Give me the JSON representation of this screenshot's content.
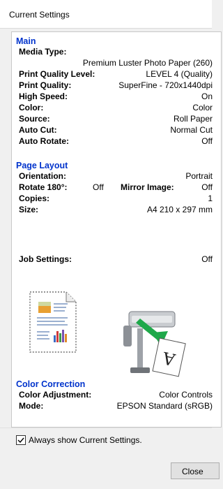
{
  "window": {
    "title": "Current Settings"
  },
  "main": {
    "heading": "Main",
    "media_type_label": "Media Type:",
    "media_type_value": "Premium Luster Photo Paper (260)",
    "print_quality_level_label": "Print Quality Level:",
    "print_quality_level_value": "LEVEL 4 (Quality)",
    "print_quality_label": "Print Quality:",
    "print_quality_value": "SuperFine - 720x1440dpi",
    "high_speed_label": "High Speed:",
    "high_speed_value": "On",
    "color_label": "Color:",
    "color_value": "Color",
    "source_label": "Source:",
    "source_value": "Roll Paper",
    "auto_cut_label": "Auto Cut:",
    "auto_cut_value": "Normal Cut",
    "auto_rotate_label": "Auto Rotate:",
    "auto_rotate_value": "Off"
  },
  "page_layout": {
    "heading": "Page Layout",
    "orientation_label": "Orientation:",
    "orientation_value": "Portrait",
    "rotate_label": "Rotate 180°:",
    "rotate_value": "Off",
    "mirror_label": "Mirror Image:",
    "mirror_value": "Off",
    "copies_label": "Copies:",
    "copies_value": "1",
    "size_label": "Size:",
    "size_value": "A4 210 x 297 mm",
    "job_settings_label": "Job Settings:",
    "job_settings_value": "Off"
  },
  "color_correction": {
    "heading": "Color Correction",
    "adjustment_label": "Color Adjustment:",
    "adjustment_value": "Color Controls",
    "mode_label": "Mode:",
    "mode_value": "EPSON Standard (sRGB)"
  },
  "footer": {
    "always_show_label": "Always show Current Settings.",
    "always_show_checked": true,
    "close_label": "Close"
  },
  "colors": {
    "section_heading": "#0033cc",
    "background": "#f0f0f0"
  },
  "icons": [
    "document-preview-icon",
    "printer-icon",
    "checkmark-icon"
  ]
}
